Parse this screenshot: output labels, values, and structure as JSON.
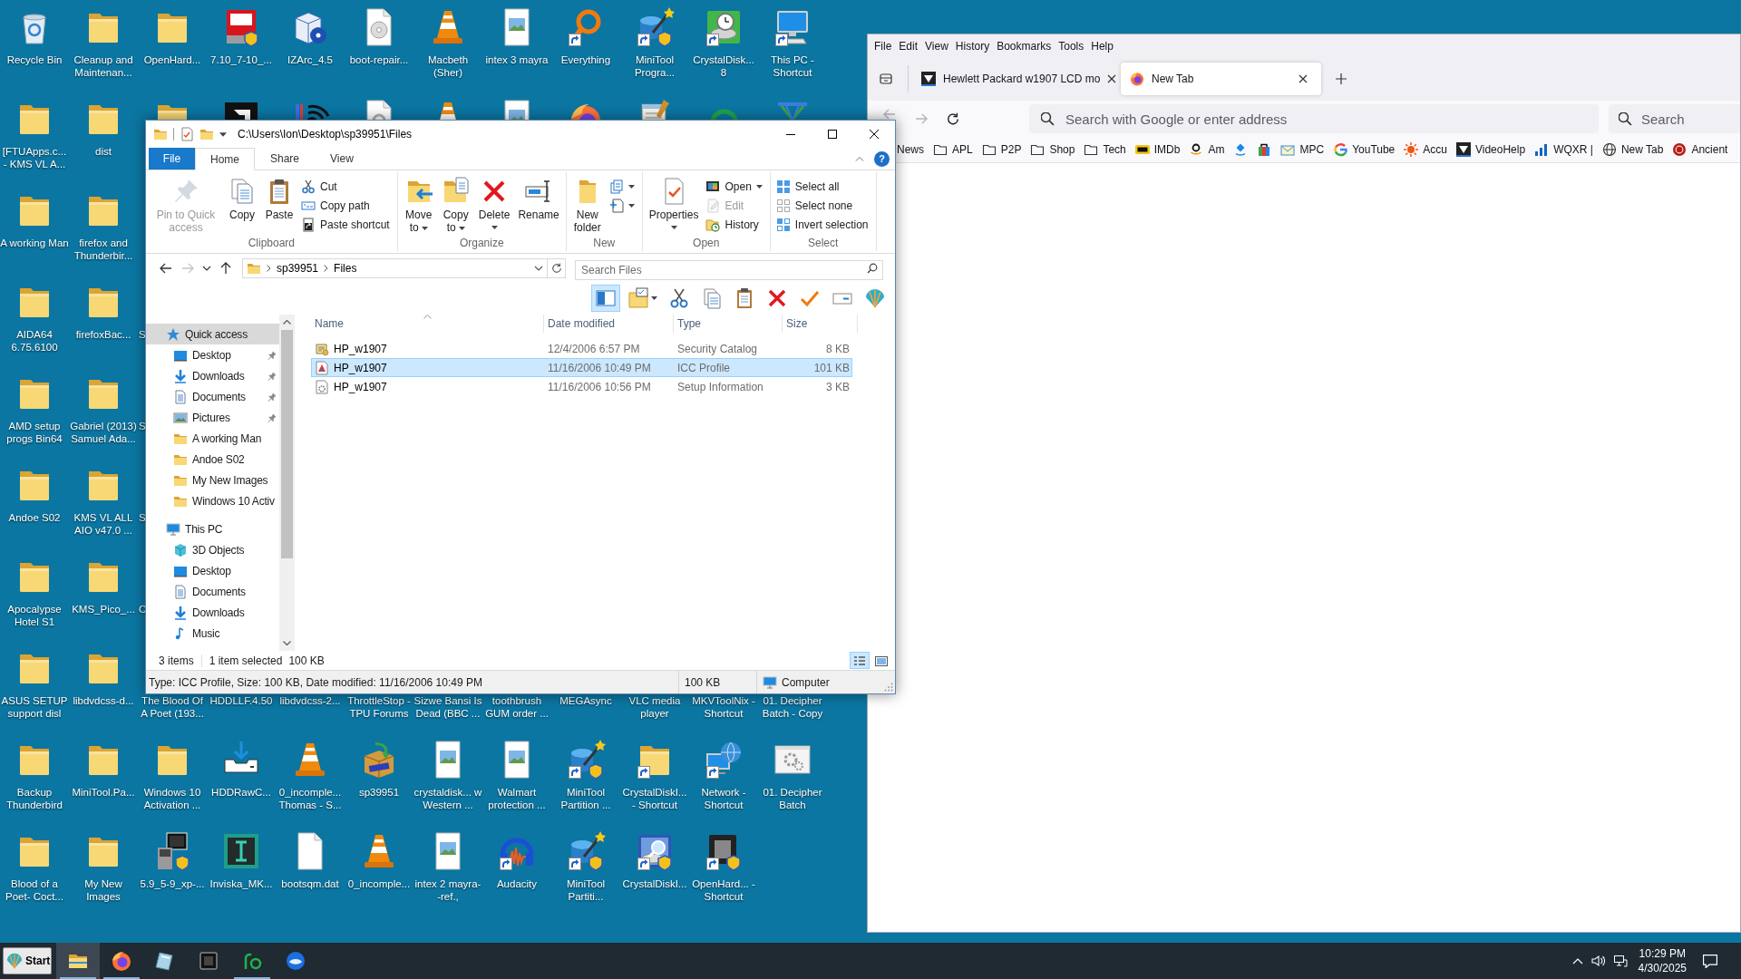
{
  "desktop": {
    "rows": [
      [
        {
          "label": "Recycle Bin",
          "kind": "recycle-bin",
          "shortcut": false
        },
        {
          "label": "Cleanup and Maintenan...",
          "kind": "folder",
          "shortcut": false
        },
        {
          "label": "OpenHard...",
          "kind": "folder",
          "shortcut": false
        },
        {
          "label": "7.10_7-10_...",
          "kind": "shield-tile",
          "shortcut": false
        },
        {
          "label": "IZArc_4.5",
          "kind": "box",
          "shortcut": false
        },
        {
          "label": "boot-repair...",
          "kind": "disc-file",
          "shortcut": false
        },
        {
          "label": "Macbeth (Sher)",
          "kind": "cone",
          "shortcut": false
        },
        {
          "label": "intex 3 mayra",
          "kind": "image-file",
          "shortcut": false
        },
        {
          "label": "Everything",
          "kind": "magnifier",
          "shortcut": true
        },
        {
          "label": "MiniTool Progra...",
          "kind": "wand",
          "shortcut": true
        },
        {
          "label": "CrystalDisk... 8",
          "kind": "disk-clock",
          "shortcut": true
        },
        {
          "label": "This PC - Shortcut",
          "kind": "monitor",
          "shortcut": true
        }
      ],
      [
        {
          "label": "[FTUApps.c... - KMS VL A...",
          "kind": "folder",
          "shortcut": false
        },
        {
          "label": "dist",
          "kind": "folder",
          "shortcut": false
        },
        {
          "kind": "folder"
        },
        {
          "kind": "dark-tile"
        },
        {
          "kind": "signal"
        },
        {
          "kind": "refresh-file"
        },
        {
          "kind": "cone"
        },
        {
          "kind": "image-file"
        },
        {
          "kind": "fox"
        },
        {
          "kind": "notepad"
        },
        {
          "kind": "hook"
        },
        {
          "kind": "cross"
        }
      ],
      [
        {
          "label": "A working Man",
          "kind": "folder",
          "shortcut": false
        },
        {
          "label": "firefox and Thunderbir...",
          "kind": "folder",
          "shortcut": false
        }
      ],
      [
        {
          "label": "AIDA64 6.75.6100",
          "kind": "folder",
          "shortcut": false
        },
        {
          "label": "firefoxBac...",
          "kind": "folder",
          "shortcut": false
        },
        {
          "label": "S",
          "kind": "cut"
        }
      ],
      [
        {
          "label": "AMD setup progs Bin64",
          "kind": "folder",
          "shortcut": false
        },
        {
          "label": "Gabriel (2013) Samuel Ada...",
          "kind": "folder",
          "shortcut": false
        },
        {
          "label": "S",
          "kind": "cut"
        }
      ],
      [
        {
          "label": "Andoe S02",
          "kind": "folder",
          "shortcut": false
        },
        {
          "label": "KMS VL ALL AIO v47.0 ...",
          "kind": "folder",
          "shortcut": false
        },
        {
          "label": "S",
          "kind": "cut"
        }
      ],
      [
        {
          "label": "Apocalypse Hotel S1",
          "kind": "folder",
          "shortcut": false
        },
        {
          "label": "KMS_Pico_...",
          "kind": "folder",
          "shortcut": false
        },
        {
          "label": "C",
          "kind": "cut"
        }
      ],
      [
        {
          "label": "ASUS SETUP support disl",
          "kind": "folder",
          "shortcut": false
        },
        {
          "label": "libdvdcss-d...",
          "kind": "folder",
          "shortcut": false
        },
        {
          "label": "The Blood Of A Poet (193...",
          "kind": "label"
        },
        {
          "label": "HDDLLF.4.50",
          "kind": "label"
        },
        {
          "label": "libdvdcss-2...",
          "kind": "label"
        },
        {
          "label": "ThrottleStop - TPU Forums",
          "kind": "label"
        },
        {
          "label": "Sizwe Bansi Is Dead (BBC ...",
          "kind": "label"
        },
        {
          "label": "toothbrush GUM order ...",
          "kind": "label"
        },
        {
          "label": "MEGAsync",
          "kind": "label"
        },
        {
          "label": "VLC media player",
          "kind": "label"
        },
        {
          "label": "MKVToolNix - Shortcut",
          "kind": "label"
        },
        {
          "label": "01. Decipher Batch - Copy",
          "kind": "label"
        }
      ],
      [
        {
          "label": "Backup Thunderbird",
          "kind": "folder",
          "shortcut": false
        },
        {
          "label": "MiniTool.Pa...",
          "kind": "folder",
          "shortcut": false
        },
        {
          "label": "Windows 10 Activation ...",
          "kind": "folder",
          "shortcut": false
        },
        {
          "label": "HDDRawC...",
          "kind": "tray",
          "shortcut": false
        },
        {
          "label": "0_incomple... Thomas - S...",
          "kind": "cone",
          "shortcut": false
        },
        {
          "label": "sp39951",
          "kind": "package",
          "shortcut": false
        },
        {
          "label": "crystaldisk... w Western ...",
          "kind": "image-file",
          "shortcut": false
        },
        {
          "label": "Walmart protection ...",
          "kind": "image-file",
          "shortcut": false
        },
        {
          "label": "MiniTool Partition ...",
          "kind": "wand",
          "shortcut": true
        },
        {
          "label": "CrystalDiskI... - Shortcut",
          "kind": "folder",
          "shortcut": true
        },
        {
          "label": "Network - Shortcut",
          "kind": "globe-computer",
          "shortcut": true
        },
        {
          "label": "01. Decipher Batch",
          "kind": "gear-window",
          "shortcut": false
        }
      ],
      [
        {
          "label": "Blood of a Poet- Coct...",
          "kind": "folder",
          "shortcut": false
        },
        {
          "label": "My New Images",
          "kind": "folder",
          "shortcut": false
        },
        {
          "label": "5.9_5-9_xp-...",
          "kind": "installer",
          "shortcut": false
        },
        {
          "label": "Inviska_MK...",
          "kind": "cursor-tile",
          "shortcut": false
        },
        {
          "label": "bootsqm.dat",
          "kind": "blank-file",
          "shortcut": false
        },
        {
          "label": "0_incomple...",
          "kind": "cone",
          "shortcut": false
        },
        {
          "label": "intex 2 mayra--ref.,",
          "kind": "image-file",
          "shortcut": false
        },
        {
          "label": "Audacity",
          "kind": "headphones",
          "shortcut": true
        },
        {
          "label": "MiniTool Partiti...",
          "kind": "wand",
          "shortcut": true
        },
        {
          "label": "CrystalDiskI...",
          "kind": "disk-search",
          "shortcut": true
        },
        {
          "label": "OpenHard... - Shortcut",
          "kind": "chip",
          "shortcut": true
        }
      ]
    ]
  },
  "explorer": {
    "title": "C:\\Users\\Ion\\Desktop\\sp39951\\Files",
    "file_tab": "File",
    "tabs": [
      {
        "label": "Home",
        "selected": true
      },
      {
        "label": "Share",
        "selected": false
      },
      {
        "label": "View",
        "selected": false
      }
    ],
    "help": "?",
    "ribbon": [
      {
        "label": "Clipboard",
        "large": [
          {
            "label": "Pin to Quick access",
            "kind": "pin",
            "disabled": true,
            "dropdown": false
          },
          {
            "label": "Copy",
            "kind": "copy",
            "disabled": false,
            "dropdown": false
          },
          {
            "label": "Paste",
            "kind": "paste",
            "disabled": false,
            "dropdown": false
          }
        ],
        "small": [
          {
            "label": "Cut",
            "kind": "cut",
            "disabled": false,
            "dropdown": false
          },
          {
            "label": "Copy path",
            "kind": "copy-path",
            "disabled": false,
            "dropdown": false
          },
          {
            "label": "Paste shortcut",
            "kind": "paste-shortcut",
            "disabled": false,
            "dropdown": false
          }
        ]
      },
      {
        "label": "Organize",
        "large": [
          {
            "label": "Move to",
            "kind": "move-to",
            "disabled": false,
            "dropdown": true
          },
          {
            "label": "Copy to",
            "kind": "copy-to",
            "disabled": false,
            "dropdown": true
          },
          {
            "label": "Delete",
            "kind": "delete",
            "disabled": false,
            "dropdown": true
          },
          {
            "label": "Rename",
            "kind": "rename",
            "disabled": false,
            "dropdown": false
          }
        ]
      },
      {
        "label": "New",
        "large": [
          {
            "label": "New folder",
            "kind": "new-folder",
            "disabled": false,
            "dropdown": false
          }
        ],
        "small": [
          {
            "kind": "new-item",
            "disabled": false,
            "dropdown": true
          },
          {
            "kind": "easy-access",
            "disabled": false,
            "dropdown": true
          }
        ]
      },
      {
        "label": "Open",
        "large": [
          {
            "label": "Properties",
            "kind": "properties",
            "disabled": false,
            "dropdown": true
          }
        ],
        "small": [
          {
            "label": "Open",
            "kind": "open",
            "disabled": false,
            "dropdown": true
          },
          {
            "label": "Edit",
            "kind": "edit",
            "disabled": true,
            "dropdown": false
          },
          {
            "label": "History",
            "kind": "history",
            "disabled": false,
            "dropdown": false
          }
        ]
      },
      {
        "label": "Select",
        "small": [
          {
            "label": "Select all",
            "kind": "select-all",
            "disabled": false,
            "dropdown": false
          },
          {
            "label": "Select none",
            "kind": "select-none",
            "disabled": false,
            "dropdown": false
          },
          {
            "label": "Invert selection",
            "kind": "invert",
            "disabled": false,
            "dropdown": false
          }
        ]
      }
    ],
    "nav_buttons": [
      {
        "kind": "back",
        "disabled": false
      },
      {
        "kind": "forward",
        "disabled": true
      },
      {
        "kind": "recent",
        "disabled": false
      },
      {
        "kind": "up",
        "disabled": false
      }
    ],
    "crumbs": [
      "sp39951",
      "Files"
    ],
    "search_placeholder": "Search Files",
    "toolbar": [
      {
        "kind": "preview-pane",
        "selected": true,
        "dropdown": false
      },
      {
        "kind": "folder-options",
        "selected": false,
        "dropdown": true
      },
      {
        "kind": "cut",
        "selected": false,
        "dropdown": false
      },
      {
        "kind": "copy",
        "selected": false,
        "dropdown": false
      },
      {
        "kind": "paste",
        "selected": false,
        "dropdown": false
      },
      {
        "kind": "delete",
        "selected": false,
        "dropdown": false
      },
      {
        "kind": "check",
        "selected": false,
        "dropdown": false
      },
      {
        "kind": "rename",
        "selected": false,
        "dropdown": false
      },
      {
        "kind": "shell",
        "selected": false,
        "dropdown": false
      }
    ],
    "nav_pane": [
      {
        "label": "Quick access",
        "kind": "star",
        "selected": true,
        "pinned": false,
        "children": [
          {
            "label": "Desktop",
            "kind": "desktop",
            "selected": false,
            "pinned": true
          },
          {
            "label": "Downloads",
            "kind": "downloads",
            "selected": false,
            "pinned": true
          },
          {
            "label": "Documents",
            "kind": "documents",
            "selected": false,
            "pinned": true
          },
          {
            "label": "Pictures",
            "kind": "pictures",
            "selected": false,
            "pinned": true
          },
          {
            "label": "A working Man",
            "kind": "folder",
            "selected": false,
            "pinned": false
          },
          {
            "label": "Andoe S02",
            "kind": "folder",
            "selected": false,
            "pinned": false
          },
          {
            "label": "My New Images",
            "kind": "folder",
            "selected": false,
            "pinned": false
          },
          {
            "label": "Windows 10 Activ",
            "kind": "folder",
            "selected": false,
            "pinned": false
          }
        ]
      },
      {
        "label": "This PC",
        "kind": "pc",
        "selected": false,
        "pinned": false,
        "children": [
          {
            "label": "3D Objects",
            "kind": "cube",
            "selected": false,
            "pinned": false
          },
          {
            "label": "Desktop",
            "kind": "desktop",
            "selected": false,
            "pinned": false
          },
          {
            "label": "Documents",
            "kind": "documents",
            "selected": false,
            "pinned": false
          },
          {
            "label": "Downloads",
            "kind": "downloads",
            "selected": false,
            "pinned": false
          },
          {
            "label": "Music",
            "kind": "music",
            "selected": false,
            "pinned": false
          }
        ]
      }
    ],
    "columns": [
      {
        "label": "Name",
        "sorted": true
      },
      {
        "label": "Date modified",
        "sorted": false
      },
      {
        "label": "Type",
        "sorted": false
      },
      {
        "label": "Size",
        "sorted": false
      }
    ],
    "files": [
      {
        "kind": "catalog",
        "selected": false,
        "cells": [
          "HP_w1907",
          "12/4/2006 6:57 PM",
          "Security Catalog",
          "8 KB"
        ]
      },
      {
        "kind": "color-profile",
        "selected": true,
        "cells": [
          "HP_w1907",
          "11/16/2006 10:49 PM",
          "ICC Profile",
          "101 KB"
        ]
      },
      {
        "kind": "setup",
        "selected": false,
        "cells": [
          "HP_w1907",
          "11/16/2006 10:56 PM",
          "Setup Information",
          "3 KB"
        ]
      }
    ],
    "status": {
      "count": "3 items",
      "selection": "1 item selected",
      "selection_size": "100 KB"
    },
    "views": [
      {
        "kind": "details",
        "selected": true
      },
      {
        "kind": "large-icons",
        "selected": false
      }
    ],
    "details_bar": {
      "description": "Type: ICC Profile, Size: 100 KB, Date modified: 11/16/2006 10:49 PM",
      "size": "100 KB",
      "location": "Computer"
    }
  },
  "firefox": {
    "menu": [
      "File",
      "Edit",
      "View",
      "History",
      "Bookmarks",
      "Tools",
      "Help"
    ],
    "tabs": [
      {
        "title": "Hewlett Packard w1907 LCD mo",
        "kind": "triangle-tile",
        "selected": false
      },
      {
        "title": "New Tab",
        "kind": "fox",
        "selected": true
      }
    ],
    "nav": [
      {
        "kind": "back",
        "disabled": true
      },
      {
        "kind": "forward",
        "disabled": true
      },
      {
        "kind": "reload",
        "disabled": false
      }
    ],
    "url_placeholder": "Search with Google or enter address",
    "search_placeholder": "Search",
    "bookmarks": [
      {
        "label": "News",
        "kind": "none"
      },
      {
        "label": "APL",
        "kind": "folder"
      },
      {
        "label": "P2P",
        "kind": "folder"
      },
      {
        "label": "Shop",
        "kind": "folder"
      },
      {
        "label": "Tech",
        "kind": "folder"
      },
      {
        "label": "IMDb",
        "kind": "tag"
      },
      {
        "label": "Am",
        "kind": "smile"
      },
      {
        "kind": "diamond"
      },
      {
        "kind": "bag"
      },
      {
        "label": "MPC",
        "kind": "envelope"
      },
      {
        "label": "YouTube",
        "kind": "arc"
      },
      {
        "label": "Accu",
        "kind": "sun"
      },
      {
        "label": "VideoHelp",
        "kind": "triangle-tile"
      },
      {
        "label": "WQXR |",
        "kind": "bars"
      },
      {
        "label": "New Tab",
        "kind": "globe"
      },
      {
        "label": "Ancient",
        "kind": "seal"
      }
    ]
  },
  "taskbar": {
    "start": "Start",
    "apps": [
      {
        "kind": "folder",
        "active": true,
        "running": true
      },
      {
        "kind": "fox",
        "active": false,
        "running": true
      },
      {
        "kind": "glass",
        "active": false,
        "running": false
      },
      {
        "kind": "dark-square",
        "active": false,
        "running": false
      },
      {
        "kind": "hook",
        "active": false,
        "running": true
      },
      {
        "kind": "bird",
        "active": false,
        "running": false
      }
    ],
    "time": "10:29 PM",
    "date": "4/30/2025"
  }
}
